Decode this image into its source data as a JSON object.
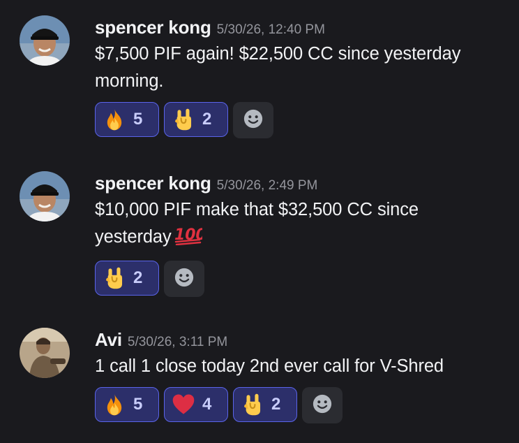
{
  "messages": [
    {
      "username": "spencer kong",
      "timestamp": "5/30/26, 12:40 PM",
      "lines": [
        "$7,500 PIF again! $22,500 CC since yesterday",
        "morning."
      ],
      "reactions": [
        {
          "emoji": "fire-emoji",
          "count": "5"
        },
        {
          "emoji": "rock-on-emoji",
          "count": "2"
        }
      ]
    },
    {
      "username": "spencer kong",
      "timestamp": "5/30/26, 2:49 PM",
      "lines": [
        "$10,000 PIF make that $32,500 CC since",
        "yesterday"
      ],
      "trailing_emoji": "hundred-points-emoji",
      "reactions": [
        {
          "emoji": "rock-on-emoji",
          "count": "2"
        }
      ]
    },
    {
      "username": "Avi",
      "timestamp": "5/30/26, 3:11 PM",
      "lines": [
        "1 call 1 close today 2nd ever call for V-Shred"
      ],
      "reactions": [
        {
          "emoji": "fire-emoji",
          "count": "5"
        },
        {
          "emoji": "heart-emoji",
          "count": "4"
        },
        {
          "emoji": "rock-on-emoji",
          "count": "2"
        }
      ]
    }
  ],
  "icons": {
    "add_reaction": "smiley-face-icon"
  },
  "colors": {
    "background": "#1a1a1e",
    "reaction_bg": "#2c2f6a",
    "reaction_border": "#5a64ea",
    "reaction_count": "#c9cdfb",
    "timestamp": "#94959c",
    "add_reaction_bg": "#2b2c31"
  }
}
